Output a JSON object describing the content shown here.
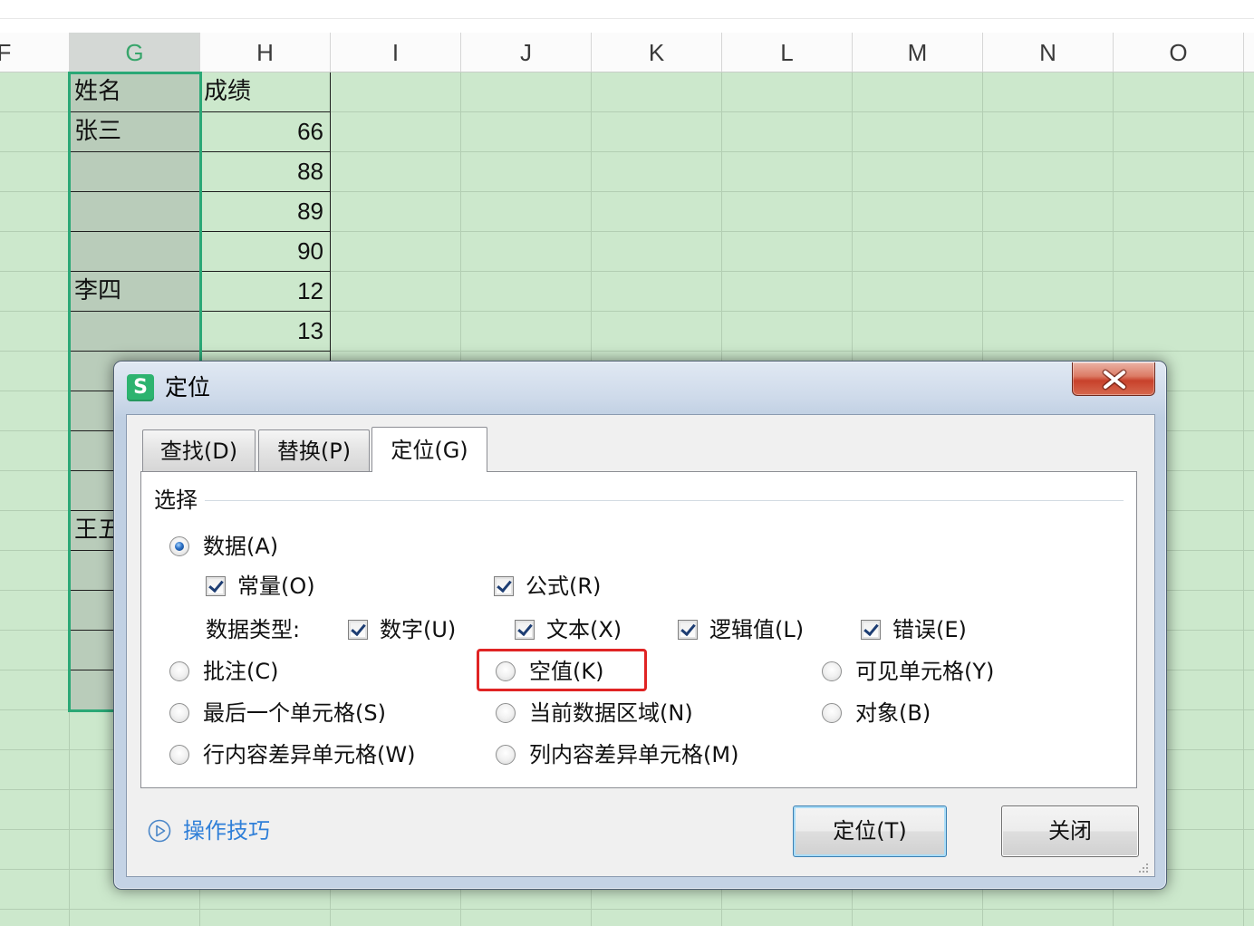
{
  "sheet": {
    "columns": [
      {
        "label": "F",
        "selected": false
      },
      {
        "label": "G",
        "selected": true
      },
      {
        "label": "H",
        "selected": false
      },
      {
        "label": "I",
        "selected": false
      },
      {
        "label": "J",
        "selected": false
      },
      {
        "label": "K",
        "selected": false
      },
      {
        "label": "L",
        "selected": false
      },
      {
        "label": "M",
        "selected": false
      },
      {
        "label": "N",
        "selected": false
      },
      {
        "label": "O",
        "selected": false
      }
    ],
    "rows": [
      {
        "g": "姓名",
        "h": "成绩"
      },
      {
        "g": "张三",
        "h": "66"
      },
      {
        "g": "",
        "h": "88"
      },
      {
        "g": "",
        "h": "89"
      },
      {
        "g": "",
        "h": "90"
      },
      {
        "g": "李四",
        "h": "12"
      },
      {
        "g": "",
        "h": "13"
      },
      {
        "g": "",
        "h": ""
      },
      {
        "g": "",
        "h": ""
      },
      {
        "g": "",
        "h": ""
      },
      {
        "g": "",
        "h": ""
      },
      {
        "g": "王五",
        "h": ""
      },
      {
        "g": "",
        "h": ""
      },
      {
        "g": "",
        "h": ""
      },
      {
        "g": "",
        "h": ""
      },
      {
        "g": "",
        "h": ""
      }
    ]
  },
  "dialog": {
    "app_icon_letter": "S",
    "title": "定位",
    "tabs": [
      {
        "label": "查找(D)",
        "active": false
      },
      {
        "label": "替换(P)",
        "active": false
      },
      {
        "label": "定位(G)",
        "active": true
      }
    ],
    "group_label": "选择",
    "options": {
      "data": {
        "label": "数据(A)",
        "checked": true
      },
      "constants": {
        "label": "常量(O)",
        "checked": true
      },
      "formulas": {
        "label": "公式(R)",
        "checked": true
      },
      "data_types_label": "数据类型:",
      "numbers": {
        "label": "数字(U)",
        "checked": true
      },
      "text": {
        "label": "文本(X)",
        "checked": true
      },
      "logicals": {
        "label": "逻辑值(L)",
        "checked": true
      },
      "errors": {
        "label": "错误(E)",
        "checked": true
      },
      "comments": {
        "label": "批注(C)",
        "checked": false
      },
      "blanks": {
        "label": "空值(K)",
        "checked": false,
        "highlighted": true
      },
      "visible_cells": {
        "label": "可见单元格(Y)",
        "checked": false
      },
      "last_cell": {
        "label": "最后一个单元格(S)",
        "checked": false
      },
      "current_region": {
        "label": "当前数据区域(N)",
        "checked": false
      },
      "objects": {
        "label": "对象(B)",
        "checked": false
      },
      "row_differences": {
        "label": "行内容差异单元格(W)",
        "checked": false
      },
      "column_differences": {
        "label": "列内容差异单元格(M)",
        "checked": false
      }
    },
    "tips_link": "操作技巧",
    "goto_button": "定位(T)",
    "close_button": "关闭"
  },
  "icons": {
    "app": "wps-app-icon",
    "close": "close-icon",
    "help": "play-circle-icon",
    "resize": "resize-grip-icon"
  },
  "colors": {
    "sheet_background": "#cce8cc",
    "gridline": "#b3ceb3",
    "selection_border": "#2aa876",
    "selected_cells": "#b9ccba",
    "highlight_box": "#e02424",
    "link": "#2f7fd8",
    "close_button": "#c8412b",
    "app_icon": "#2db36f"
  }
}
